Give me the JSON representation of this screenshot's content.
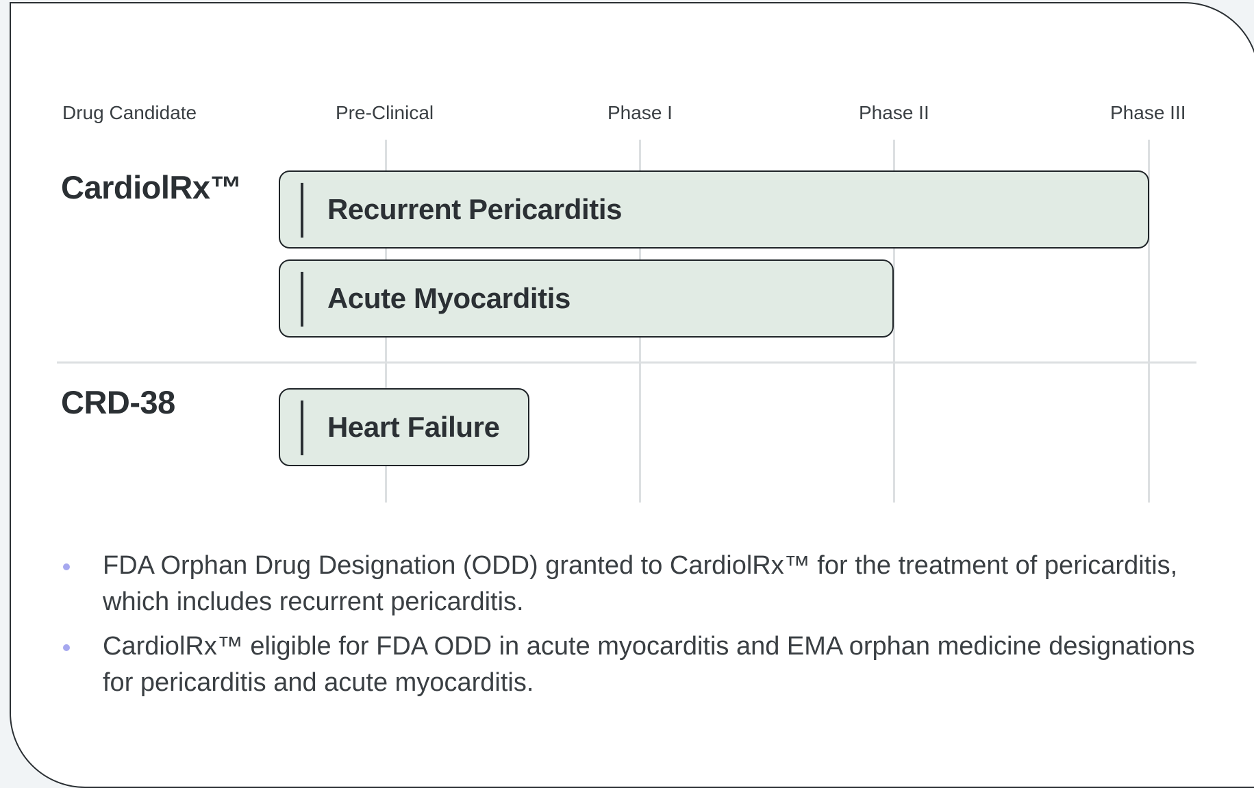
{
  "headers": {
    "drug_candidate": "Drug Candidate",
    "preclinical": "Pre-Clinical",
    "phase1": "Phase I",
    "phase2": "Phase II",
    "phase3": "Phase III"
  },
  "candidates": [
    {
      "name": "CardiolRx™",
      "indications": [
        {
          "label": "Recurrent Pericarditis",
          "stage": "Phase III"
        },
        {
          "label": "Acute Myocarditis",
          "stage": "Phase II"
        }
      ]
    },
    {
      "name": "CRD-38",
      "indications": [
        {
          "label": "Heart Failure",
          "stage": "Pre-Clinical"
        }
      ]
    }
  ],
  "notes": [
    "FDA Orphan Drug Designation (ODD) granted to CardiolRx™ for the treatment of pericarditis, which includes recurrent pericarditis.",
    "CardiolRx™ eligible for FDA ODD in acute myocarditis and EMA orphan medicine designations for pericarditis and acute myocarditis."
  ],
  "colors": {
    "bar_fill": "#e1ebe4",
    "bar_border": "#1f2428",
    "gridline": "#dcdfe1",
    "bullet": "#a6a8ef"
  }
}
